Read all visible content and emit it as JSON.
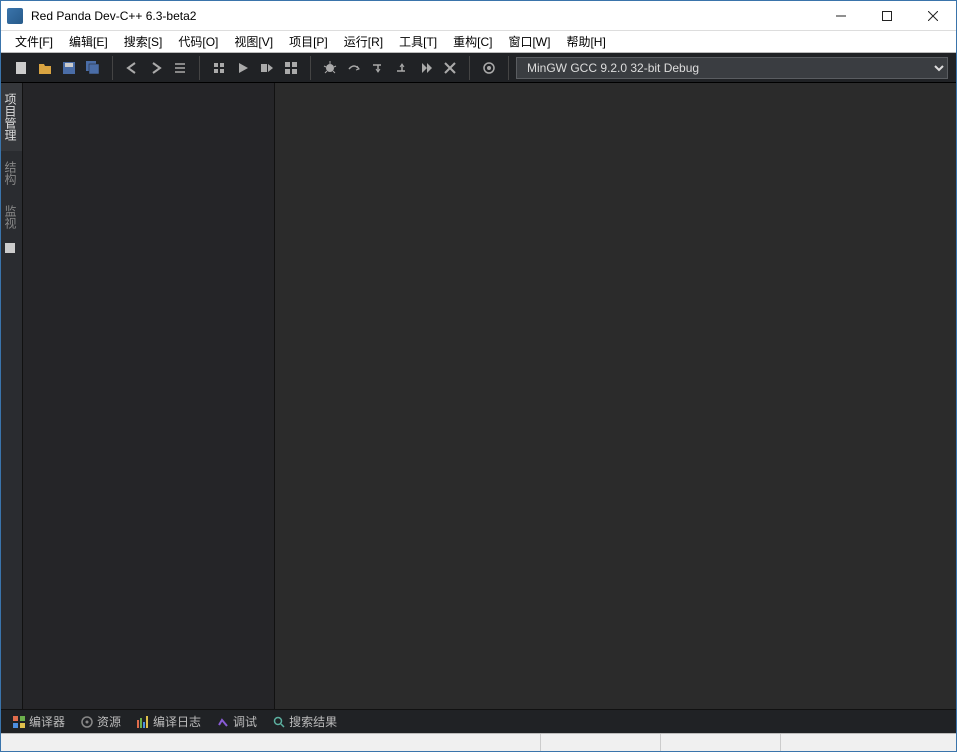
{
  "window": {
    "title": "Red Panda Dev-C++ 6.3-beta2"
  },
  "menu": {
    "items": [
      "文件[F]",
      "编辑[E]",
      "搜索[S]",
      "代码[O]",
      "视图[V]",
      "项目[P]",
      "运行[R]",
      "工具[T]",
      "重构[C]",
      "窗口[W]",
      "帮助[H]"
    ]
  },
  "toolbar": {
    "compiler_select": "MinGW GCC 9.2.0 32-bit Debug"
  },
  "side_tabs": {
    "items": [
      "项目管理",
      "结构",
      "监视"
    ]
  },
  "bottom_tabs": {
    "items": [
      "编译器",
      "资源",
      "编译日志",
      "调试",
      "搜索结果"
    ]
  }
}
